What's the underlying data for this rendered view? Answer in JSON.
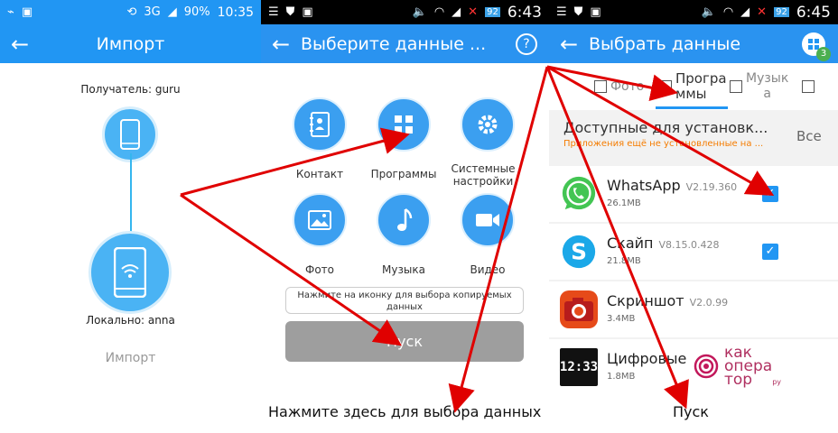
{
  "panel1": {
    "status": {
      "network": "3G",
      "battery": "90%",
      "time": "10:35"
    },
    "title": "Импорт",
    "receiver": "Получатель: guru",
    "local": "Локально: anna",
    "import_label": "Импорт"
  },
  "panel2": {
    "status": {
      "battery_badge": "92",
      "time": "6:43"
    },
    "title": "Выберите данные ...",
    "items": [
      {
        "label": "Контакт",
        "icon": "contacts-icon"
      },
      {
        "label": "Программы",
        "icon": "apps-icon"
      },
      {
        "label": "Системные настройки",
        "icon": "settings-icon"
      },
      {
        "label": "Фото",
        "icon": "photo-icon"
      },
      {
        "label": "Музыка",
        "icon": "music-icon"
      },
      {
        "label": "Видео",
        "icon": "video-icon"
      }
    ],
    "hint": "Нажмите на иконку для выбора копируемых данных",
    "start_label": "Пуск"
  },
  "panel3": {
    "status": {
      "battery_badge": "92",
      "time": "6:45"
    },
    "title": "Выбрать данные",
    "badge_count": "3",
    "tabs": [
      {
        "label": "Фото"
      },
      {
        "label": "Програ\nммы"
      },
      {
        "label": "Музык\nа"
      }
    ],
    "section_title": "Доступные для установк...",
    "section_subtitle": "Приложения ещё не установленные на ...",
    "section_all": "Все",
    "apps": [
      {
        "name": "WhatsApp",
        "version": "V2.19.360",
        "size": "26.1MB",
        "checked": true
      },
      {
        "name": "Скайп",
        "version": "V8.15.0.428",
        "size": "21.8MB",
        "checked": true
      },
      {
        "name": "Скриншот",
        "version": "V2.0.99",
        "size": "3.4MB",
        "checked": false
      },
      {
        "name": "Цифровые",
        "version": "",
        "size": "1.8MB",
        "checked": false
      }
    ]
  },
  "logo": {
    "text": "как\nопера\nтор",
    "suffix": "ру"
  },
  "captions": {
    "left": "Нажмите здесь для выбора данных",
    "right": "Пуск"
  },
  "colors": {
    "primary": "#2196f3",
    "arrow": "#e00000",
    "accent": "#f57c00"
  }
}
